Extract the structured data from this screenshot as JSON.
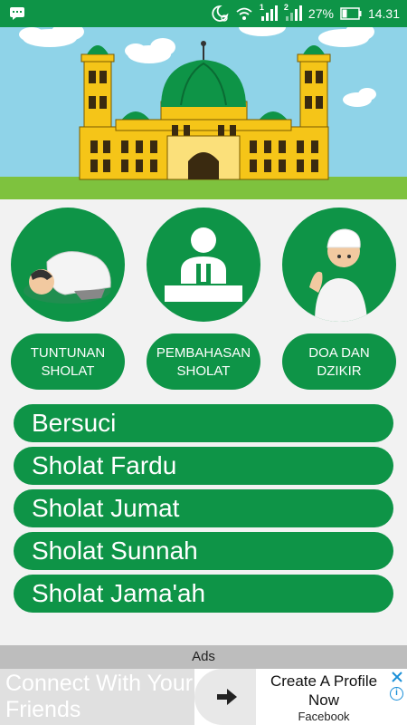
{
  "status_bar": {
    "battery_percent": "27%",
    "time": "14.31",
    "sim1": "1",
    "sim2": "2"
  },
  "categories": [
    {
      "label": "TUNTUNAN\nSHOLAT",
      "icon": "prostrating-man-icon"
    },
    {
      "label": "PEMBAHASAN\nSHOLAT",
      "icon": "speaker-podium-icon"
    },
    {
      "label": "DOA DAN\nDZIKIR",
      "icon": "praying-boy-icon"
    }
  ],
  "menu": [
    "Bersuci",
    "Sholat Fardu",
    "Sholat Jumat",
    "Sholat Sunnah",
    "Sholat Jama'ah"
  ],
  "ads": {
    "header": "Ads",
    "left_text": "Connect With Your Friends",
    "cta": "Create A Profile Now",
    "source": "Facebook"
  },
  "colors": {
    "primary_green": "#0e9447",
    "sky": "#8fd3e8"
  }
}
